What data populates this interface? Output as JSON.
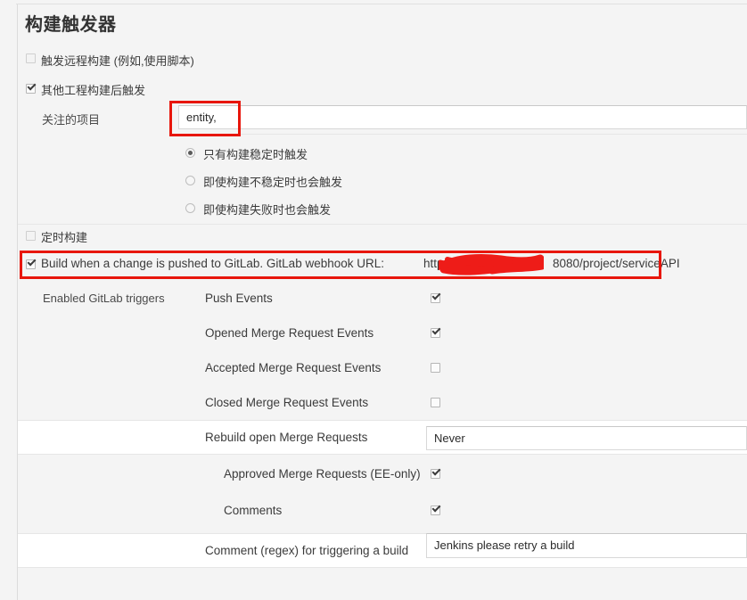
{
  "page": {
    "title": "构建触发器"
  },
  "triggers": {
    "remote_build": {
      "label": "触发远程构建 (例如,使用脚本)",
      "checked": false
    },
    "after_other_projects": {
      "label": "其他工程构建后触发",
      "checked": true,
      "watched_projects_label": "关注的项目",
      "watched_projects_value": "entity,",
      "threshold_options": [
        {
          "label": "只有构建稳定时触发",
          "selected": true
        },
        {
          "label": "即使构建不稳定时也会触发",
          "selected": false
        },
        {
          "label": "即使构建失败时也会触发",
          "selected": false
        }
      ]
    },
    "scheduled_build": {
      "label": "定时构建",
      "checked": false
    },
    "gitlab": {
      "checked": true,
      "label_prefix": "Build when a change is pushed to GitLab. GitLab webhook URL:",
      "url_head": "http://1",
      "url_tail": "8080/project/serviceAPI",
      "enabled_triggers_label": "Enabled GitLab triggers",
      "events": [
        {
          "label": "Push Events",
          "checked": true
        },
        {
          "label": "Opened Merge Request Events",
          "checked": true
        },
        {
          "label": "Accepted Merge Request Events",
          "checked": false
        },
        {
          "label": "Closed Merge Request Events",
          "checked": false
        }
      ],
      "rebuild_open_mr": {
        "label": "Rebuild open Merge Requests",
        "value": "Never"
      },
      "approved_mr": {
        "label": "Approved Merge Requests (EE-only)",
        "checked": true
      },
      "comments": {
        "label": "Comments",
        "checked": true
      },
      "comment_regex": {
        "label": "Comment (regex) for triggering a build",
        "value": "Jenkins please retry a build"
      }
    }
  },
  "colors": {
    "annotation": "#e8160c",
    "redaction": "#ee1c18",
    "row_white": "#ffffff",
    "row_grey": "#f4f4f4"
  }
}
